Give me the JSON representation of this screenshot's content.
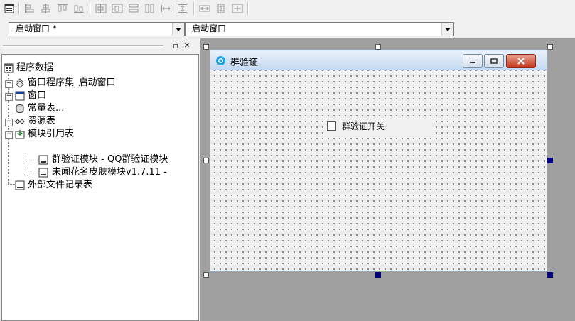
{
  "combo": {
    "window_selector": "_启动窗口 *",
    "control_selector": "_启动窗口"
  },
  "panel": {
    "minimize_glyph": "▫",
    "close_glyph": "✕"
  },
  "tree": {
    "root": "程序数据",
    "items": [
      {
        "label": "窗口程序集_启动窗口",
        "icon": "assembly-icon"
      },
      {
        "label": "窗口",
        "icon": "window-icon"
      },
      {
        "label": "常量表...",
        "icon": "constant-table-icon"
      },
      {
        "label": "资源表",
        "icon": "resource-icon"
      },
      {
        "label": "模块引用表",
        "icon": "module-ref-icon"
      },
      {
        "label": "群验证模块 - QQ群验证模块",
        "icon": "module-file-icon"
      },
      {
        "label": "未闻花名皮肤模块v1.7.11 -",
        "icon": "module-file-icon"
      },
      {
        "label": "外部文件记录表",
        "icon": "module-file-icon"
      }
    ]
  },
  "form": {
    "title": "群验证",
    "checkbox_label": "群验证开关"
  },
  "colors": {
    "accent": "#000080",
    "titlebar_top": "#e9f1fb",
    "titlebar_bottom": "#c6d9ef",
    "close_button": "#c2361b"
  }
}
